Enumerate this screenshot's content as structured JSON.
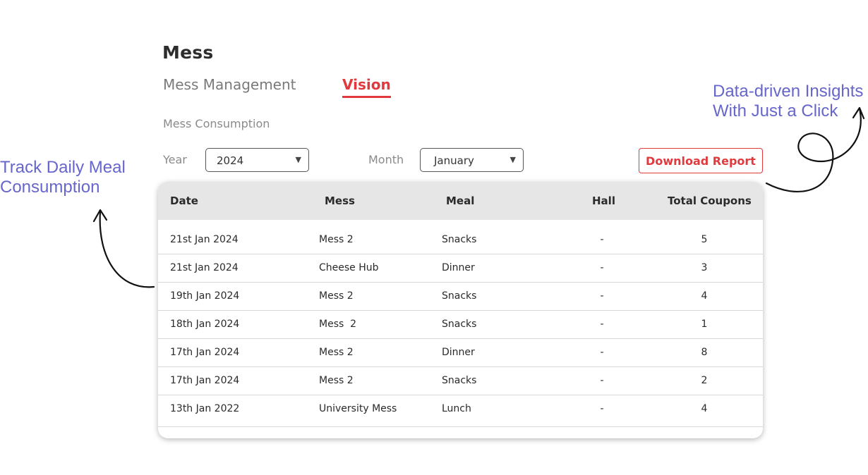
{
  "header": {
    "title": "Mess"
  },
  "tabs": [
    {
      "label": "Mess Management",
      "active": false
    },
    {
      "label": "Vision",
      "active": true
    }
  ],
  "section": {
    "label": "Mess Consumption"
  },
  "filters": {
    "year_label": "Year",
    "year_value": "2024",
    "month_label": "Month",
    "month_value": "January"
  },
  "actions": {
    "download_label": "Download Report"
  },
  "table": {
    "columns": [
      "Date",
      "Mess",
      "Meal",
      "Hall",
      "Total Coupons"
    ],
    "rows": [
      [
        "21st Jan 2024",
        "Mess 2",
        "Snacks",
        "-",
        "5"
      ],
      [
        "21st Jan 2024",
        "Cheese Hub",
        "Dinner",
        "-",
        "3"
      ],
      [
        "19th Jan 2024",
        "Mess 2",
        "Snacks",
        "-",
        "4"
      ],
      [
        "18th Jan 2024",
        "Mess  2",
        "Snacks",
        "-",
        "1"
      ],
      [
        "17th Jan 2024",
        "Mess 2",
        "Dinner",
        "-",
        "8"
      ],
      [
        "17th Jan 2024",
        "Mess 2",
        "Snacks",
        "-",
        "2"
      ],
      [
        "13th Jan 2022",
        "University Mess",
        "Lunch",
        "-",
        "4"
      ]
    ]
  },
  "annotations": {
    "left_line1": "Track Daily Meal",
    "left_line2": "Consumption",
    "right_line1": "Data-driven Insights",
    "right_line2": "With Just a Click"
  },
  "colors": {
    "accent": "#e0393e",
    "annotation": "#6666cc",
    "header_bg": "#e6e6e6"
  }
}
